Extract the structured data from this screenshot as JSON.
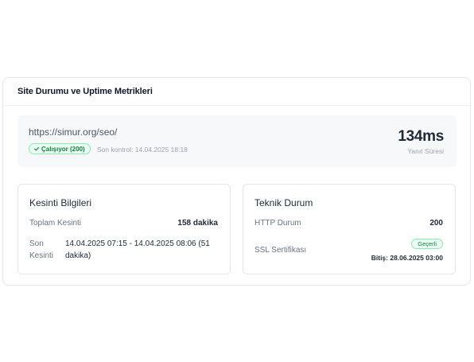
{
  "card": {
    "title": "Site Durumu ve Uptime Metrikleri"
  },
  "status": {
    "url": "https://simur.org/seo/",
    "badge": "Çalışıyor (200)",
    "last_check": "Son kontrol: 14.04.2025 18:18",
    "response_time": "134ms",
    "response_label": "Yanıt Süresi"
  },
  "outage": {
    "title": "Kesinti Bilgileri",
    "total_label": "Toplam Kesinti",
    "total_value": "158 dakika",
    "last_label": "Son Kesinti",
    "last_value": "14.04.2025 07:15 - 14.04.2025 08:06 (51 dakika)"
  },
  "technical": {
    "title": "Teknik Durum",
    "http_label": "HTTP Durum",
    "http_value": "200",
    "ssl_label": "SSL Sertifikası",
    "ssl_badge": "Geçerli",
    "ssl_expiry": "Bitiş: 28.06.2025 03:00"
  },
  "colors": {
    "success": "#15803d",
    "success_bg": "#ecfdf5",
    "panel_bg": "#f7f8fa"
  },
  "icons": {
    "status_badge_icon": "check-icon"
  }
}
